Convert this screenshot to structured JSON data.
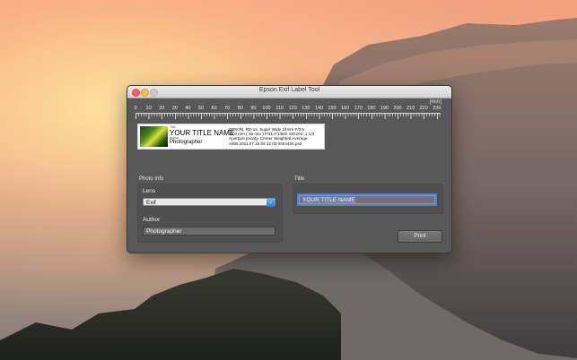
{
  "window": {
    "title": "Epson Exif Label Tool"
  },
  "ruler": {
    "unit": "[mm]",
    "ticks": [
      "0",
      "10",
      "20",
      "30",
      "40",
      "50",
      "60",
      "70",
      "80",
      "90",
      "100",
      "110",
      "120",
      "130",
      "140",
      "150",
      "160",
      "170",
      "180",
      "190",
      "200",
      "210",
      "220",
      "230"
    ]
  },
  "preview": {
    "title_caption": "Title",
    "title": "YOUR TITLE NAME",
    "author_caption": "Author",
    "author": "Photographer",
    "exif_lines": [
      "EPSON, RD-1s, Super Wide 24mm F/3.5",
      "24.0 mm ( 36 mm ) F/11.0 1/80s ISO200 -1 1/3",
      "Aperture priority, Center Weighted Average",
      "AWB 2011:07:16 06:12:02 0004426.psd"
    ]
  },
  "photo_info": {
    "group_label": "Photo Info",
    "lens_label": "Lens",
    "lens_value": "Exif",
    "author_label": "Author",
    "author_value": "Photographer"
  },
  "title_section": {
    "label": "Title",
    "value": "YOUR TITLE NAME"
  },
  "print_button": "Print",
  "colors": {
    "window_bg": "#585858",
    "accent": "#1e7bf2",
    "focus_ring": "#6aa3ea"
  }
}
